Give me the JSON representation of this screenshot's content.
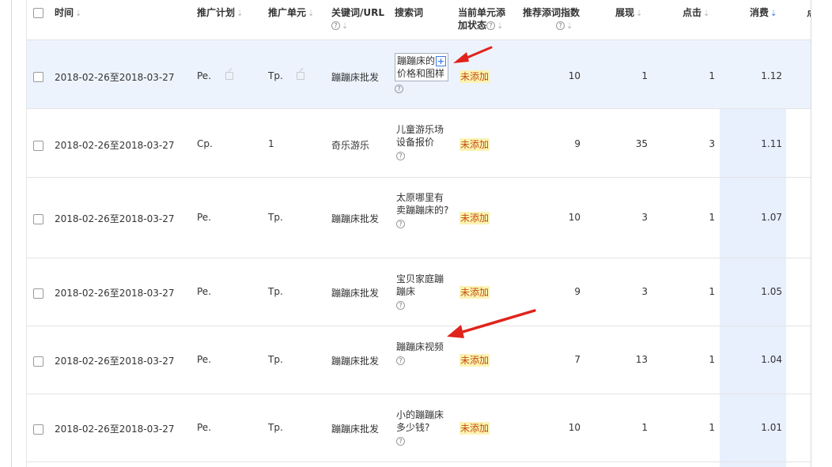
{
  "header": {
    "time": "时间",
    "plan": "推广计划",
    "unit": "推广单元",
    "keyword": "关键词/URL",
    "search_term": "搜索词",
    "status_line1": "当前单元添",
    "status_line2": "加状态",
    "index_line1": "推荐添词指数",
    "impressions": "展现",
    "clicks": "点击",
    "cost": "消费",
    "cutoff": "点"
  },
  "icons": {
    "sort": "arrow-down-icon",
    "help": "question-circle-icon",
    "edit": "edit-icon",
    "add": "plus-icon"
  },
  "help_glyph": "?",
  "sort_glyph": "⇣",
  "add_glyph": "+",
  "colors": {
    "highlight_row": "#edf3fd",
    "sort_column": "#e8effd",
    "badge_bg": "#fbf3b4",
    "badge_text": "#c4500e",
    "accent": "#3b7be0",
    "annotation": "#e0231b"
  },
  "rows": [
    {
      "time": "2018-02-26至2018-03-27",
      "plan": "Pe.",
      "unit": "Tp.",
      "keyword": "蹦蹦床批发",
      "term_line1": "蹦蹦床的",
      "term_line2": "价格和图样",
      "status": "未添加",
      "index": "10",
      "impressions": "1",
      "clicks": "1",
      "cost": "1.12"
    },
    {
      "time": "2018-02-26至2018-03-27",
      "plan": "Cp.",
      "unit": "1",
      "keyword": "奇乐游乐",
      "term": "儿童游乐场设备报价",
      "status": "未添加",
      "index": "9",
      "impressions": "35",
      "clicks": "3",
      "cost": "1.11"
    },
    {
      "time": "2018-02-26至2018-03-27",
      "plan": "Pe.",
      "unit": "Tp.",
      "keyword": "蹦蹦床批发",
      "term": "太原哪里有卖蹦蹦床的?",
      "status": "未添加",
      "index": "10",
      "impressions": "3",
      "clicks": "1",
      "cost": "1.07"
    },
    {
      "time": "2018-02-26至2018-03-27",
      "plan": "Pe.",
      "unit": "Tp.",
      "keyword": "蹦蹦床批发",
      "term": "宝贝家庭蹦蹦床",
      "status": "未添加",
      "index": "9",
      "impressions": "3",
      "clicks": "1",
      "cost": "1.05"
    },
    {
      "time": "2018-02-26至2018-03-27",
      "plan": "Pe.",
      "unit": "Tp.",
      "keyword": "蹦蹦床批发",
      "term": "蹦蹦床视频",
      "status": "未添加",
      "index": "7",
      "impressions": "13",
      "clicks": "1",
      "cost": "1.04"
    },
    {
      "time": "2018-02-26至2018-03-27",
      "plan": "Pe.",
      "unit": "Tp.",
      "keyword": "蹦蹦床批发",
      "term": "小的蹦蹦床多少钱?",
      "status": "未添加",
      "index": "10",
      "impressions": "1",
      "clicks": "1",
      "cost": "1.01"
    }
  ]
}
